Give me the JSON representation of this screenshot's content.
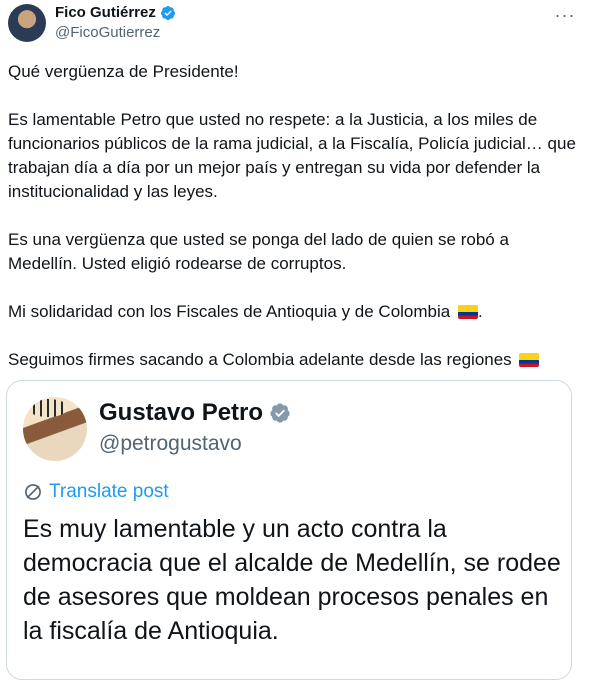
{
  "tweet": {
    "display_name": "Fico Gutiérrez",
    "handle": "@FicoGutierrez",
    "verified_icon": "verified-badge-icon",
    "more_icon": "more-options-icon",
    "more_glyph": "···",
    "paragraphs": [
      "Qué vergüenza de Presidente!",
      "Es lamentable Petro que usted no respete: a la Justicia, a los miles de funcionarios públicos de la rama judicial, a la Fiscalía, Policía judicial… que trabajan día a día por un mejor país y entregan su vida por defender la institucionalidad y las leyes.",
      "Es una vergüenza que usted se ponga del lado de quien se robó a Medellín. Usted eligió rodearse de corruptos.",
      "Mi solidaridad con los Fiscales de Antioquia y de Colombia",
      "Seguimos firmes sacando a Colombia adelante desde las regiones"
    ],
    "para4_suffix": ".",
    "flag_icon": "colombia-flag-icon"
  },
  "quoted": {
    "display_name": "Gustavo Petro",
    "handle": "@petrogustavo",
    "translate_label": "Translate post",
    "translate_icon": "translate-globe-icon",
    "text": "Es muy lamentable y un acto contra la democracia que el alcalde de Medellín, se rodee de asesores que moldean procesos penales en la fiscalía de Antioquia."
  },
  "colors": {
    "verified_blue": "#1d9bf0",
    "link_blue": "#1d9bf0",
    "secondary_text": "#536471",
    "border": "#cfd9de"
  }
}
